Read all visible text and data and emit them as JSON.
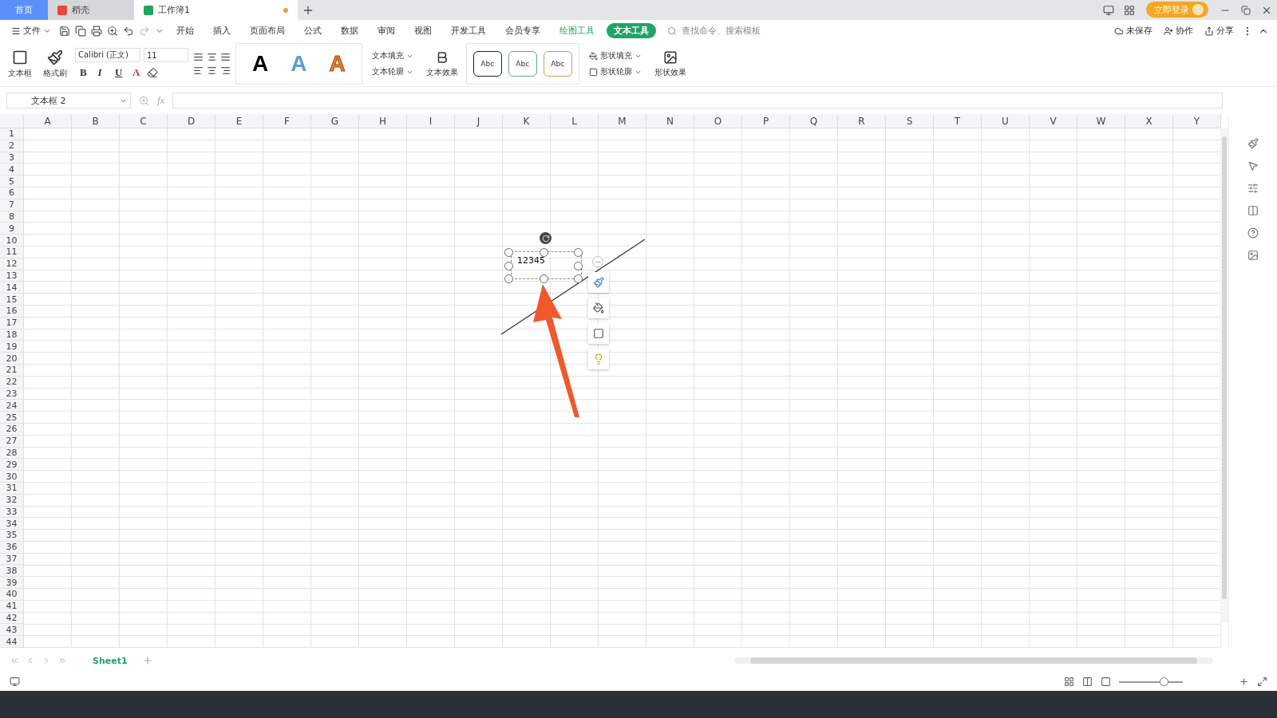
{
  "title_tabs": [
    {
      "label": "首页",
      "kind": "home",
      "selected": false
    },
    {
      "label": "稻壳",
      "kind": "docer",
      "selected": false
    },
    {
      "label": "工作簿1",
      "kind": "sheet",
      "selected": true,
      "unsaved": true
    }
  ],
  "login_button": "立即登录",
  "file_menu": "文件",
  "menu": [
    {
      "label": "开始",
      "kind": "plain",
      "selected": false
    },
    {
      "label": "插入",
      "kind": "plain",
      "selected": false
    },
    {
      "label": "页面布局",
      "kind": "plain",
      "selected": false
    },
    {
      "label": "公式",
      "kind": "plain",
      "selected": false
    },
    {
      "label": "数据",
      "kind": "plain",
      "selected": false
    },
    {
      "label": "审阅",
      "kind": "plain",
      "selected": false
    },
    {
      "label": "视图",
      "kind": "plain",
      "selected": false
    },
    {
      "label": "开发工具",
      "kind": "plain",
      "selected": false
    },
    {
      "label": "会员专享",
      "kind": "plain",
      "selected": false
    },
    {
      "label": "绘图工具",
      "kind": "context",
      "selected": false
    },
    {
      "label": "文本工具",
      "kind": "context",
      "selected": true
    }
  ],
  "search": {
    "placeholder": "查找命令、搜索模板"
  },
  "top_actions": [
    "未保存",
    "协作",
    "分享"
  ],
  "ribbon": {
    "textbox": "文本框",
    "format_painter": "格式刷",
    "font_name": "Calibri (正文)",
    "font_size": "11",
    "format_buttons": [
      "B",
      "I",
      "U",
      "A"
    ],
    "text_styles": [
      {
        "label": "A",
        "color": "#000000"
      },
      {
        "label": "A",
        "color": "#5b9bd5"
      },
      {
        "label": "A",
        "color": "#ed7d31"
      }
    ],
    "text_fill": "文本填充",
    "text_outline": "文本轮廓",
    "text_effect": "文本效果",
    "shape_styles": [
      {
        "label": "Abc",
        "color": "#222222"
      },
      {
        "label": "Abc",
        "color": "#6a9fb5"
      },
      {
        "label": "Abc",
        "color": "#d49a5a"
      }
    ],
    "shape_fill": "形状填充",
    "shape_outline": "形状轮廓",
    "shape_effect": "形状效果"
  },
  "name_box": "文本框 2",
  "formula_label": "fx",
  "columns": [
    "A",
    "B",
    "C",
    "D",
    "E",
    "F",
    "G",
    "H",
    "I",
    "J",
    "K",
    "L",
    "M",
    "N",
    "O",
    "P",
    "Q",
    "R",
    "S",
    "T",
    "U",
    "V",
    "W",
    "X",
    "Y"
  ],
  "rows": [
    "1",
    "2",
    "3",
    "4",
    "5",
    "6",
    "7",
    "8",
    "9",
    "10",
    "11",
    "12",
    "13",
    "14",
    "15",
    "16",
    "17",
    "18",
    "19",
    "20",
    "21",
    "22",
    "23",
    "24",
    "25",
    "26",
    "27",
    "28",
    "29",
    "30",
    "31",
    "32",
    "33",
    "34",
    "35",
    "36",
    "37",
    "38",
    "39",
    "40",
    "41",
    "42",
    "43",
    "44"
  ],
  "textbox": {
    "text": "12345"
  },
  "sheet_tabs": [
    {
      "label": "Sheet1",
      "selected": true
    }
  ],
  "zoom": {
    "level": 0.7
  }
}
